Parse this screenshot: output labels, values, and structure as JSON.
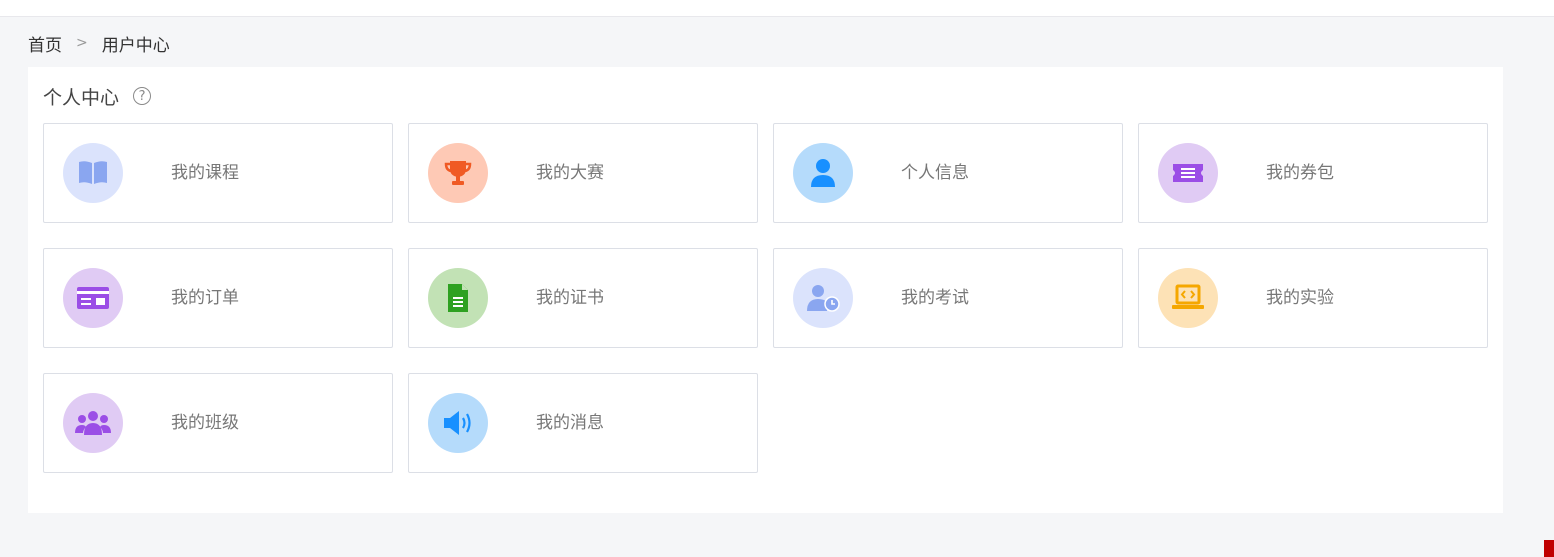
{
  "breadcrumb": {
    "home": "首页",
    "separator": ">",
    "current": "用户中心"
  },
  "panel": {
    "title": "个人中心",
    "help_icon_glyph": "?"
  },
  "cards": [
    {
      "label": "我的课程",
      "icon": "book-icon",
      "bg": "#dbe3fc",
      "fg": "#8aa6f0"
    },
    {
      "label": "我的大赛",
      "icon": "trophy-icon",
      "bg": "#fec9b5",
      "fg": "#f05a24"
    },
    {
      "label": "个人信息",
      "icon": "user-icon",
      "bg": "#b5dbfb",
      "fg": "#1890ff"
    },
    {
      "label": "我的券包",
      "icon": "ticket-icon",
      "bg": "#e0cbf4",
      "fg": "#9b4ee6"
    },
    {
      "label": "我的订单",
      "icon": "order-card-icon",
      "bg": "#e0cbf4",
      "fg": "#9b4ee6"
    },
    {
      "label": "我的证书",
      "icon": "certificate-icon",
      "bg": "#c2e2b5",
      "fg": "#2ea121"
    },
    {
      "label": "我的考试",
      "icon": "exam-user-icon",
      "bg": "#dbe3fc",
      "fg": "#8aa6f0"
    },
    {
      "label": "我的实验",
      "icon": "laptop-code-icon",
      "bg": "#fde2b6",
      "fg": "#f5a700"
    },
    {
      "label": "我的班级",
      "icon": "group-icon",
      "bg": "#e0cbf4",
      "fg": "#9b4ee6"
    },
    {
      "label": "我的消息",
      "icon": "speaker-icon",
      "bg": "#b5dbfb",
      "fg": "#1890ff"
    }
  ]
}
